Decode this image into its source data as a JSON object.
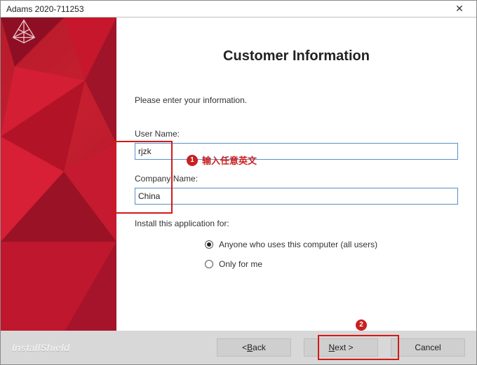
{
  "window": {
    "title": "Adams 2020-711253"
  },
  "page": {
    "heading": "Customer Information",
    "instruction": "Please enter your information."
  },
  "fields": {
    "username_label": "User Name:",
    "username_value": "rjzk",
    "company_label": "Company Name:",
    "company_value": "China"
  },
  "install_for": {
    "question": "Install this application for:",
    "opt_all": "Anyone who uses this computer (all users)",
    "opt_me": "Only for me",
    "selected": "all"
  },
  "footer": {
    "brand": "InstallShield",
    "back_pre": "< ",
    "back_u": "B",
    "back_post": "ack",
    "next_u": "N",
    "next_post": "ext >",
    "cancel": "Cancel"
  },
  "annotations": {
    "badge1": "1",
    "text1": "输入任意英文",
    "badge2": "2"
  }
}
